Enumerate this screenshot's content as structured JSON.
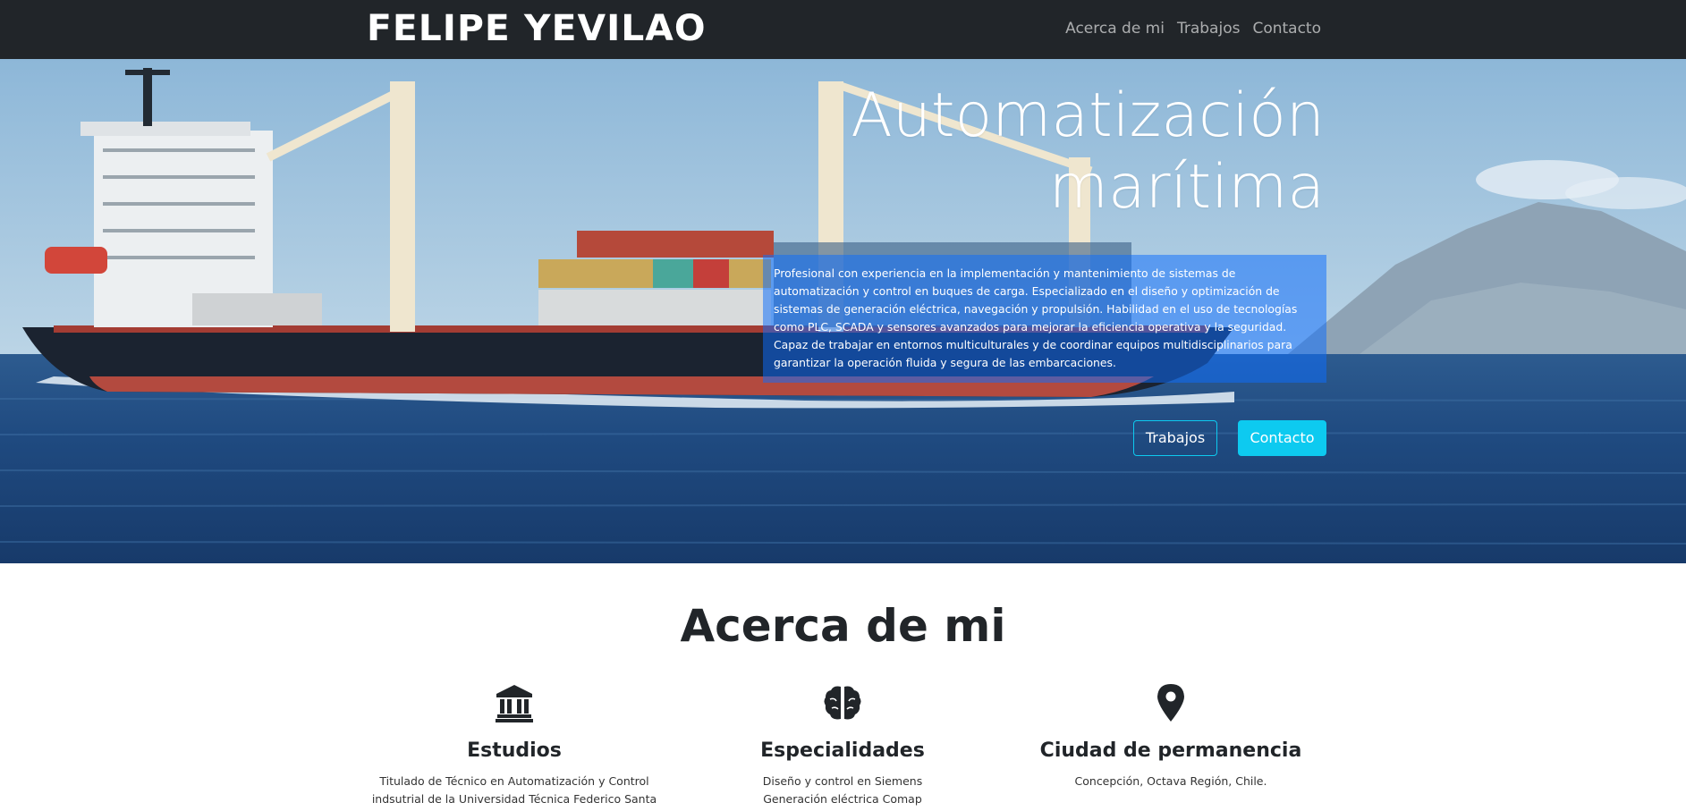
{
  "navbar": {
    "brand": "FELIPE YEVILAO",
    "links": [
      "Acerca de mi",
      "Trabajos",
      "Contacto"
    ]
  },
  "hero": {
    "title_line1": "Automatización",
    "title_line2": "marítima",
    "description": "Profesional con experiencia en la implementación y mantenimiento de sistemas de automatización y control en buques de carga. Especializado en el diseño y optimización de sistemas de generación eléctrica, navegación y propulsión. Habilidad en el uso de tecnologías como PLC, SCADA y sensores avanzados para mejorar la eficiencia operativa y la seguridad. Capaz de trabajar en entornos multiculturales y de coordinar equipos multidisciplinarios para garantizar la operación fluida y segura de las embarcaciones.",
    "button_outline": "Trabajos",
    "button_primary": "Contacto"
  },
  "about": {
    "title": "Acerca de mi",
    "features": [
      {
        "icon": "institution-icon",
        "heading": "Estudios",
        "line1": "Titulado de Técnico en Automatización y Control",
        "line2": "indsutrial de la Universidad Técnica Federico Santa"
      },
      {
        "icon": "brain-icon",
        "heading": "Especialidades",
        "line1": "Diseño y control en Siemens",
        "line2": "Generación eléctrica Comap"
      },
      {
        "icon": "map-pin-icon",
        "heading": "Ciudad de permanencia",
        "line1": "Concepción, Octava Región, Chile.",
        "line2": ""
      }
    ]
  },
  "colors": {
    "navbar_bg": "#212529",
    "accent_info": "#0dcaf0",
    "desc_box": "#0d6efd"
  }
}
